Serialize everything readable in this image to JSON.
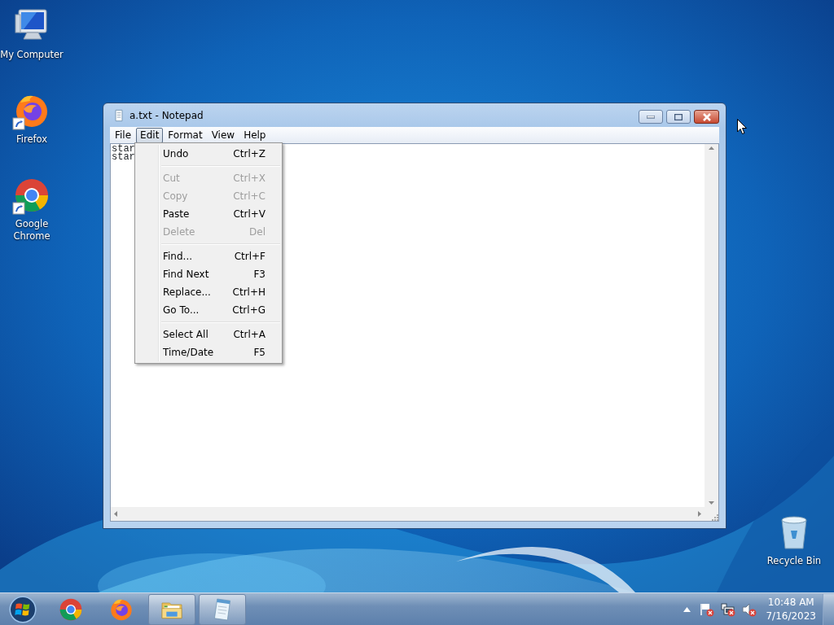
{
  "desktop_icons": [
    {
      "kind": "computer",
      "label": "My Computer",
      "shortcut": false
    },
    {
      "kind": "firefox",
      "label": "Firefox",
      "shortcut": true
    },
    {
      "kind": "chrome",
      "label": "Google Chrome",
      "shortcut": true
    }
  ],
  "recycle_bin": {
    "kind": "recycle",
    "label": "Recycle Bin"
  },
  "window": {
    "title": "a.txt - Notepad",
    "menu": [
      {
        "label": "File",
        "selected": false
      },
      {
        "label": "Edit",
        "selected": true
      },
      {
        "label": "Format",
        "selected": false
      },
      {
        "label": "View",
        "selected": false
      },
      {
        "label": "Help",
        "selected": false
      }
    ],
    "text_lines": [
      "star",
      "star"
    ]
  },
  "edit_menu": [
    [
      {
        "label": "Undo",
        "shortcut": "Ctrl+Z",
        "disabled": false
      }
    ],
    [
      {
        "label": "Cut",
        "shortcut": "Ctrl+X",
        "disabled": true
      },
      {
        "label": "Copy",
        "shortcut": "Ctrl+C",
        "disabled": true
      },
      {
        "label": "Paste",
        "shortcut": "Ctrl+V",
        "disabled": false
      },
      {
        "label": "Delete",
        "shortcut": "Del",
        "disabled": true
      }
    ],
    [
      {
        "label": "Find...",
        "shortcut": "Ctrl+F",
        "disabled": false
      },
      {
        "label": "Find Next",
        "shortcut": "F3",
        "disabled": false
      },
      {
        "label": "Replace...",
        "shortcut": "Ctrl+H",
        "disabled": false
      },
      {
        "label": "Go To...",
        "shortcut": "Ctrl+G",
        "disabled": false
      }
    ],
    [
      {
        "label": "Select All",
        "shortcut": "Ctrl+A",
        "disabled": false
      },
      {
        "label": "Time/Date",
        "shortcut": "F5",
        "disabled": false
      }
    ]
  ],
  "taskbar": {
    "apps": [
      {
        "kind": "chrome",
        "running": false
      },
      {
        "kind": "firefox",
        "running": false
      },
      {
        "kind": "explorer",
        "running": true
      },
      {
        "kind": "notepad",
        "running": true
      }
    ],
    "tray": [
      {
        "kind": "flag"
      },
      {
        "kind": "network"
      },
      {
        "kind": "volume"
      }
    ],
    "time": "10:48 AM",
    "date": "7/16/2023"
  }
}
